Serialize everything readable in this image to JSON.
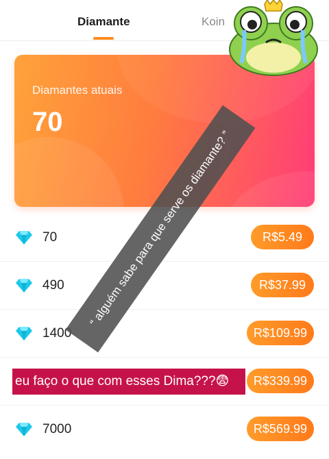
{
  "tabs": [
    {
      "label": "Diamante",
      "active": true
    },
    {
      "label": "Koin",
      "active": false
    }
  ],
  "balance": {
    "label": "Diamantes atuais",
    "value": "70"
  },
  "packages": [
    {
      "amount": "70",
      "price": "R$5.49"
    },
    {
      "amount": "490",
      "price": "R$37.99"
    },
    {
      "amount": "1400",
      "price": "R$109.99"
    },
    {
      "amount": "",
      "price": "R$339.99"
    },
    {
      "amount": "7000",
      "price": "R$569.99"
    }
  ],
  "overlays": {
    "diagonal_text": "“ alguém sabe para que serve os diamante? ”",
    "caption_text": "eu faço o que com esses Dima???😨"
  },
  "icons": {
    "diamond": "diamond-icon",
    "sticker": "crying-frog-sticker"
  },
  "colors": {
    "accent": "#ff8a1e",
    "price_button": "#ff8a24",
    "card_start": "#ffa23a",
    "card_end": "#ff3c78",
    "diamond": "#1ec8e8",
    "caption_bg": "#c6124a"
  }
}
